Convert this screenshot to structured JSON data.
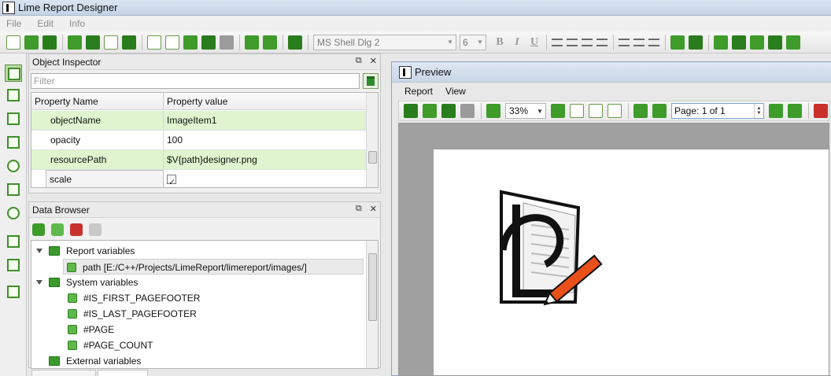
{
  "window": {
    "title": "Lime Report Designer"
  },
  "menubar": {
    "items": [
      "File",
      "Edit",
      "Info"
    ]
  },
  "toolbar": {
    "font_family": "MS Shell Dlg 2",
    "font_size": "6",
    "bold": "B",
    "italic": "I",
    "underline": "U"
  },
  "object_inspector": {
    "title": "Object Inspector",
    "filter_placeholder": "Filter",
    "col_name": "Property Name",
    "col_value": "Property value",
    "rows": [
      {
        "name": "objectName",
        "value": "ImageItem1"
      },
      {
        "name": "opacity",
        "value": "100"
      },
      {
        "name": "resourcePath",
        "value": "$V{path}designer.png"
      },
      {
        "name": "scale",
        "value": ""
      }
    ],
    "scale_checked": true
  },
  "data_browser": {
    "title": "Data Browser",
    "report_variables": "Report variables",
    "path_var": "path  [E:/C++/Projects/LimeReport/limereport/images/]",
    "system_variables": "System variables",
    "sys_items": [
      "#IS_FIRST_PAGEFOOTER",
      "#IS_LAST_PAGEFOOTER",
      "#PAGE",
      "#PAGE_COUNT"
    ],
    "external_variables": "External variables"
  },
  "preview": {
    "title": "Preview",
    "menu": [
      "Report",
      "View"
    ],
    "zoom": "33%",
    "page_indicator": "Page: 1 of 1"
  },
  "colors": {
    "accent": "#3f9b2a",
    "row_highlight": "#dff4cf"
  }
}
